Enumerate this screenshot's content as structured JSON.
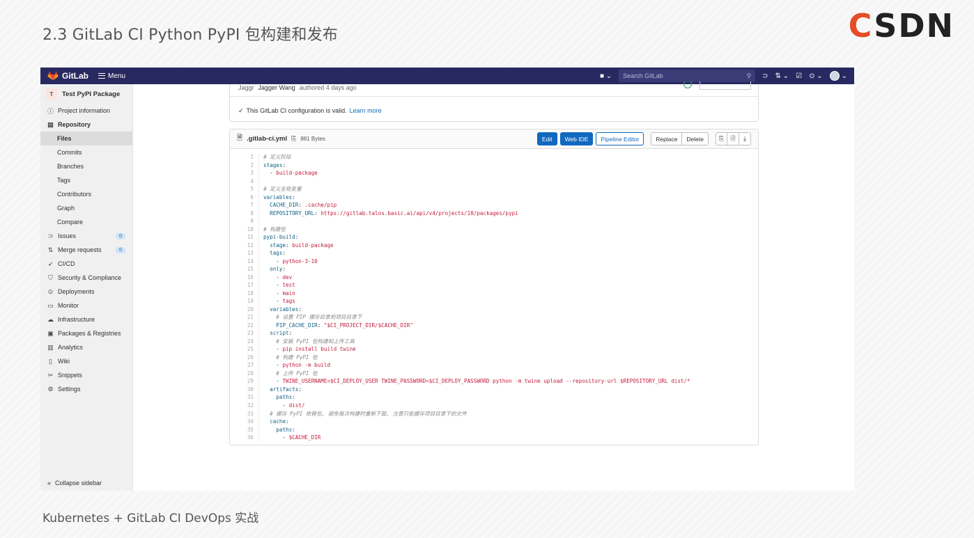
{
  "slide": {
    "title": "2.3 GitLab CI Python PyPI 包构建和发布",
    "logo": "CSDN",
    "footer": "Kubernetes + GitLab CI DevOps 实战"
  },
  "topbar": {
    "brand": "GitLab",
    "menu": "Menu",
    "search_placeholder": "Search GitLab",
    "icons": [
      "plus-icon",
      "search-icon",
      "issues-icon",
      "merge-request-icon",
      "todo-icon",
      "help-icon",
      "avatar"
    ]
  },
  "sidebar": {
    "project_initial": "T",
    "project_name": "Test PyPI Package",
    "items": [
      {
        "label": "Project information",
        "icon": "info-icon"
      },
      {
        "label": "Repository",
        "icon": "repository-icon"
      },
      {
        "label": "Files"
      },
      {
        "label": "Commits"
      },
      {
        "label": "Branches"
      },
      {
        "label": "Tags"
      },
      {
        "label": "Contributors"
      },
      {
        "label": "Graph"
      },
      {
        "label": "Compare"
      },
      {
        "label": "Issues",
        "icon": "issues-icon",
        "count": "0"
      },
      {
        "label": "Merge requests",
        "icon": "merge-request-icon",
        "count": "0"
      },
      {
        "label": "CI/CD",
        "icon": "rocket-icon"
      },
      {
        "label": "Security & Compliance",
        "icon": "shield-icon"
      },
      {
        "label": "Deployments",
        "icon": "deployments-icon"
      },
      {
        "label": "Monitor",
        "icon": "monitor-icon"
      },
      {
        "label": "Infrastructure",
        "icon": "cloud-icon"
      },
      {
        "label": "Packages & Registries",
        "icon": "package-icon"
      },
      {
        "label": "Analytics",
        "icon": "chart-icon"
      },
      {
        "label": "Wiki",
        "icon": "book-icon"
      },
      {
        "label": "Snippets",
        "icon": "scissors-icon"
      },
      {
        "label": "Settings",
        "icon": "gear-icon"
      }
    ],
    "collapse_label": "Collapse sidebar"
  },
  "commit": {
    "avatar_text": "Jaggr",
    "author": "Jagger Wang",
    "meta": "authored 4 days ago",
    "valid_text": "This GitLab CI configuration is valid.",
    "learn_more": "Learn more"
  },
  "file": {
    "name": ".gitlab-ci.yml",
    "size": "881 Bytes",
    "buttons": {
      "edit": "Edit",
      "web_ide": "Web IDE",
      "pipeline_editor": "Pipeline Editor",
      "replace": "Replace",
      "delete": "Delete"
    },
    "code": [
      [
        [
          "c-com",
          "# 定义阶段"
        ]
      ],
      [
        [
          "c-key",
          "stages"
        ],
        [
          "c-dash",
          ":"
        ]
      ],
      [
        [
          "c-dash",
          "  - "
        ],
        [
          "c-val",
          "build-package"
        ]
      ],
      [],
      [
        [
          "c-com",
          "# 定义全局变量"
        ]
      ],
      [
        [
          "c-key",
          "variables"
        ],
        [
          "c-dash",
          ":"
        ]
      ],
      [
        [
          "c-dash",
          "  "
        ],
        [
          "c-key",
          "CACHE_DIR"
        ],
        [
          "c-dash",
          ": "
        ],
        [
          "c-val",
          ".cache/pip"
        ]
      ],
      [
        [
          "c-dash",
          "  "
        ],
        [
          "c-key",
          "REPOSITORY_URL"
        ],
        [
          "c-dash",
          ": "
        ],
        [
          "c-val",
          "https://gitlab.talos.basic.ai/api/v4/projects/10/packages/pypi"
        ]
      ],
      [],
      [
        [
          "c-com",
          "# 构建包"
        ]
      ],
      [
        [
          "c-key",
          "pypi-build"
        ],
        [
          "c-dash",
          ":"
        ]
      ],
      [
        [
          "c-dash",
          "  "
        ],
        [
          "c-key",
          "stage"
        ],
        [
          "c-dash",
          ": "
        ],
        [
          "c-val",
          "build-package"
        ]
      ],
      [
        [
          "c-dash",
          "  "
        ],
        [
          "c-key",
          "tags"
        ],
        [
          "c-dash",
          ":"
        ]
      ],
      [
        [
          "c-dash",
          "    - "
        ],
        [
          "c-val",
          "python-3-10"
        ]
      ],
      [
        [
          "c-dash",
          "  "
        ],
        [
          "c-key",
          "only"
        ],
        [
          "c-dash",
          ":"
        ]
      ],
      [
        [
          "c-dash",
          "    - "
        ],
        [
          "c-val",
          "dev"
        ]
      ],
      [
        [
          "c-dash",
          "    - "
        ],
        [
          "c-val",
          "test"
        ]
      ],
      [
        [
          "c-dash",
          "    - "
        ],
        [
          "c-val",
          "main"
        ]
      ],
      [
        [
          "c-dash",
          "    - "
        ],
        [
          "c-val",
          "tags"
        ]
      ],
      [
        [
          "c-dash",
          "  "
        ],
        [
          "c-key",
          "variables"
        ],
        [
          "c-dash",
          ":"
        ]
      ],
      [
        [
          "c-dash",
          "    "
        ],
        [
          "c-com",
          "# 设置 PIP 缓存目录到项目目录下"
        ]
      ],
      [
        [
          "c-dash",
          "    "
        ],
        [
          "c-key",
          "PIP_CACHE_DIR"
        ],
        [
          "c-dash",
          ": "
        ],
        [
          "c-val",
          "\"$CI_PROJECT_DIR/$CACHE_DIR\""
        ]
      ],
      [
        [
          "c-dash",
          "  "
        ],
        [
          "c-key",
          "script"
        ],
        [
          "c-dash",
          ":"
        ]
      ],
      [
        [
          "c-dash",
          "    "
        ],
        [
          "c-com",
          "# 安装 PyPI 包构建和上传工具"
        ]
      ],
      [
        [
          "c-dash",
          "    - "
        ],
        [
          "c-val",
          "pip install build twine"
        ]
      ],
      [
        [
          "c-dash",
          "    "
        ],
        [
          "c-com",
          "# 构建 PyPI 包"
        ]
      ],
      [
        [
          "c-dash",
          "    - "
        ],
        [
          "c-val",
          "python -m build"
        ]
      ],
      [
        [
          "c-dash",
          "    "
        ],
        [
          "c-com",
          "# 上传 PyPI 包"
        ]
      ],
      [
        [
          "c-dash",
          "    - "
        ],
        [
          "c-val",
          "TWINE_USERNAME=$CI_DEPLOY_USER TWINE_PASSWORD=$CI_DEPLOY_PASSWORD python -m twine upload --repository-url $REPOSITORY_URL dist/*"
        ]
      ],
      [
        [
          "c-dash",
          "  "
        ],
        [
          "c-key",
          "artifacts"
        ],
        [
          "c-dash",
          ":"
        ]
      ],
      [
        [
          "c-dash",
          "    "
        ],
        [
          "c-key",
          "paths"
        ],
        [
          "c-dash",
          ":"
        ]
      ],
      [
        [
          "c-dash",
          "      - "
        ],
        [
          "c-val",
          "dist/"
        ]
      ],
      [
        [
          "c-dash",
          "  "
        ],
        [
          "c-com",
          "# 缓存 PyPI 依赖包, 避免每次构建时重新下载, 注意只能缓存项目目录下的文件"
        ]
      ],
      [
        [
          "c-dash",
          "  "
        ],
        [
          "c-key",
          "cache"
        ],
        [
          "c-dash",
          ":"
        ]
      ],
      [
        [
          "c-dash",
          "    "
        ],
        [
          "c-key",
          "paths"
        ],
        [
          "c-dash",
          ":"
        ]
      ],
      [
        [
          "c-dash",
          "      - "
        ],
        [
          "c-val",
          "$CACHE_DIR"
        ]
      ]
    ]
  }
}
